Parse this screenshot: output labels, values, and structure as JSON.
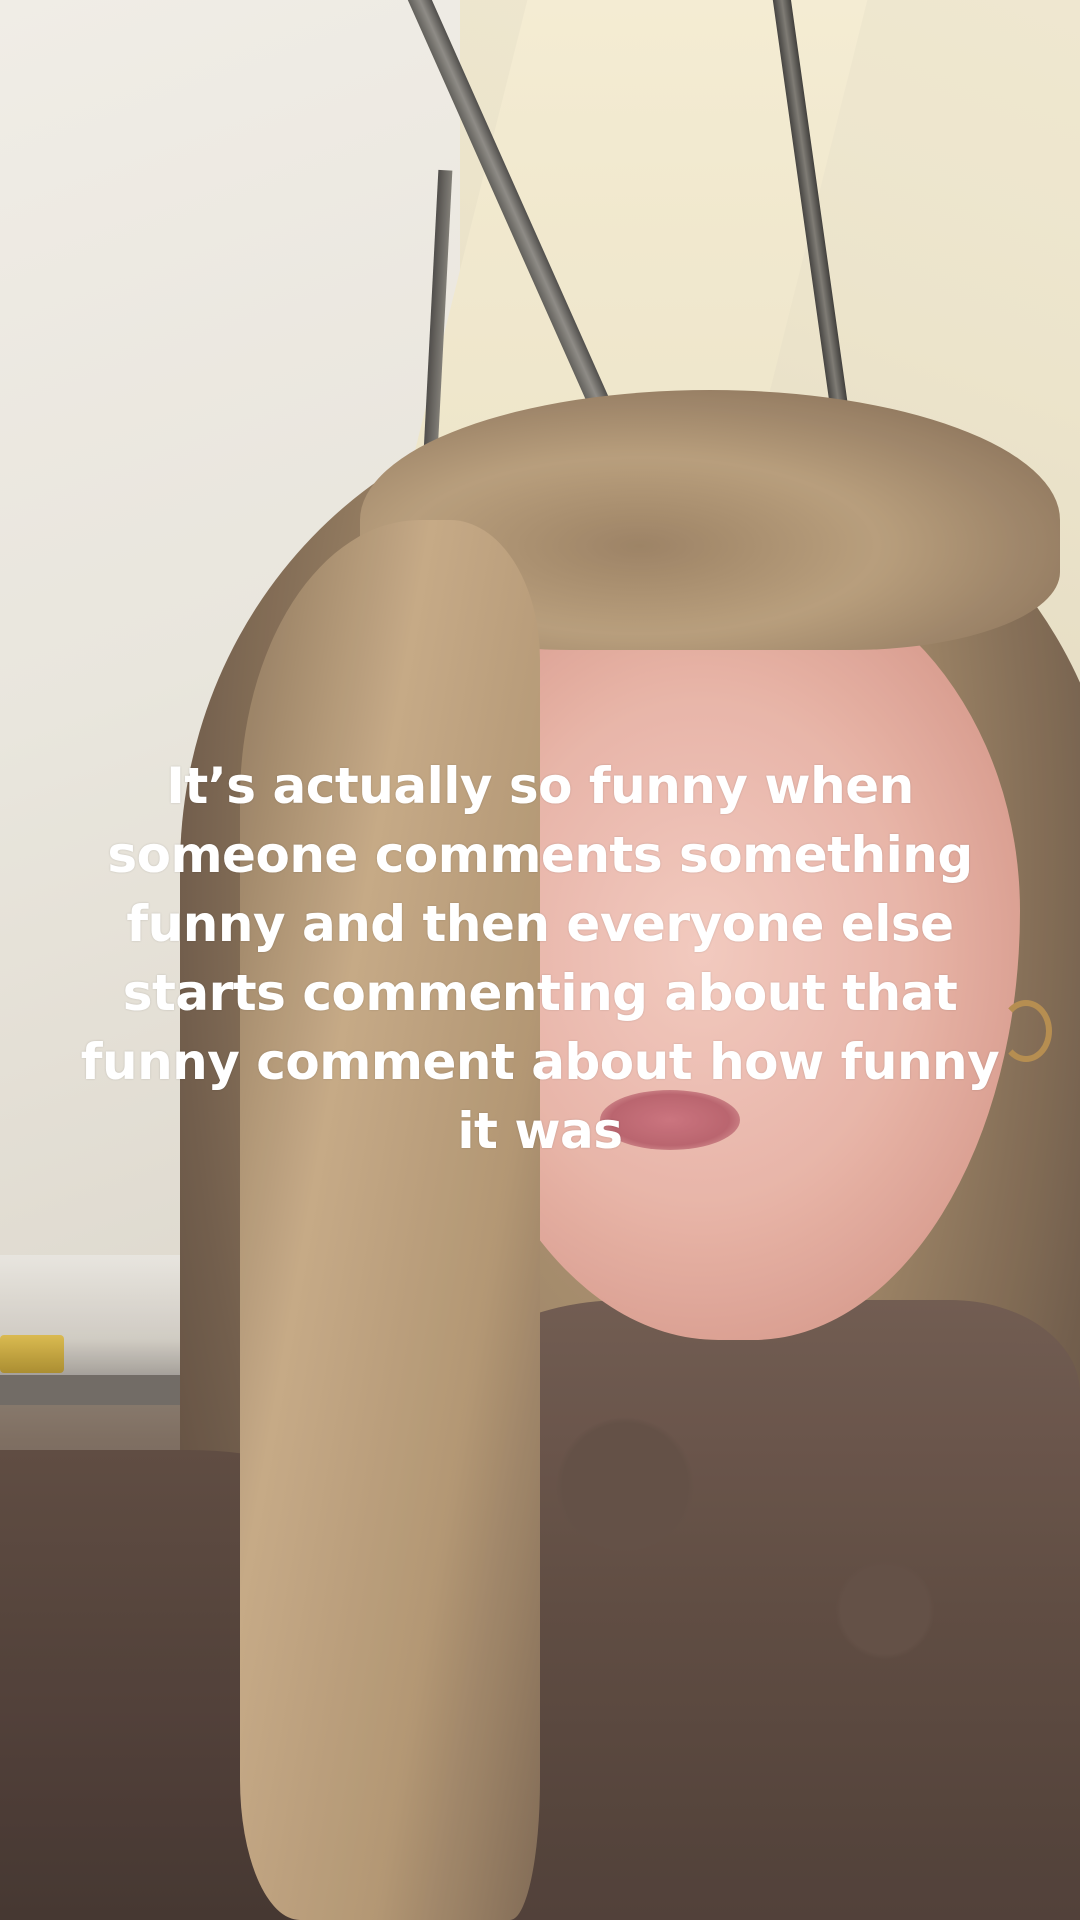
{
  "video": {
    "caption": "It’s actually so funny when\nsomeone comments something\nfunny and then everyone else\nstarts commenting about that\nfunny comment about how funny\nit was"
  }
}
